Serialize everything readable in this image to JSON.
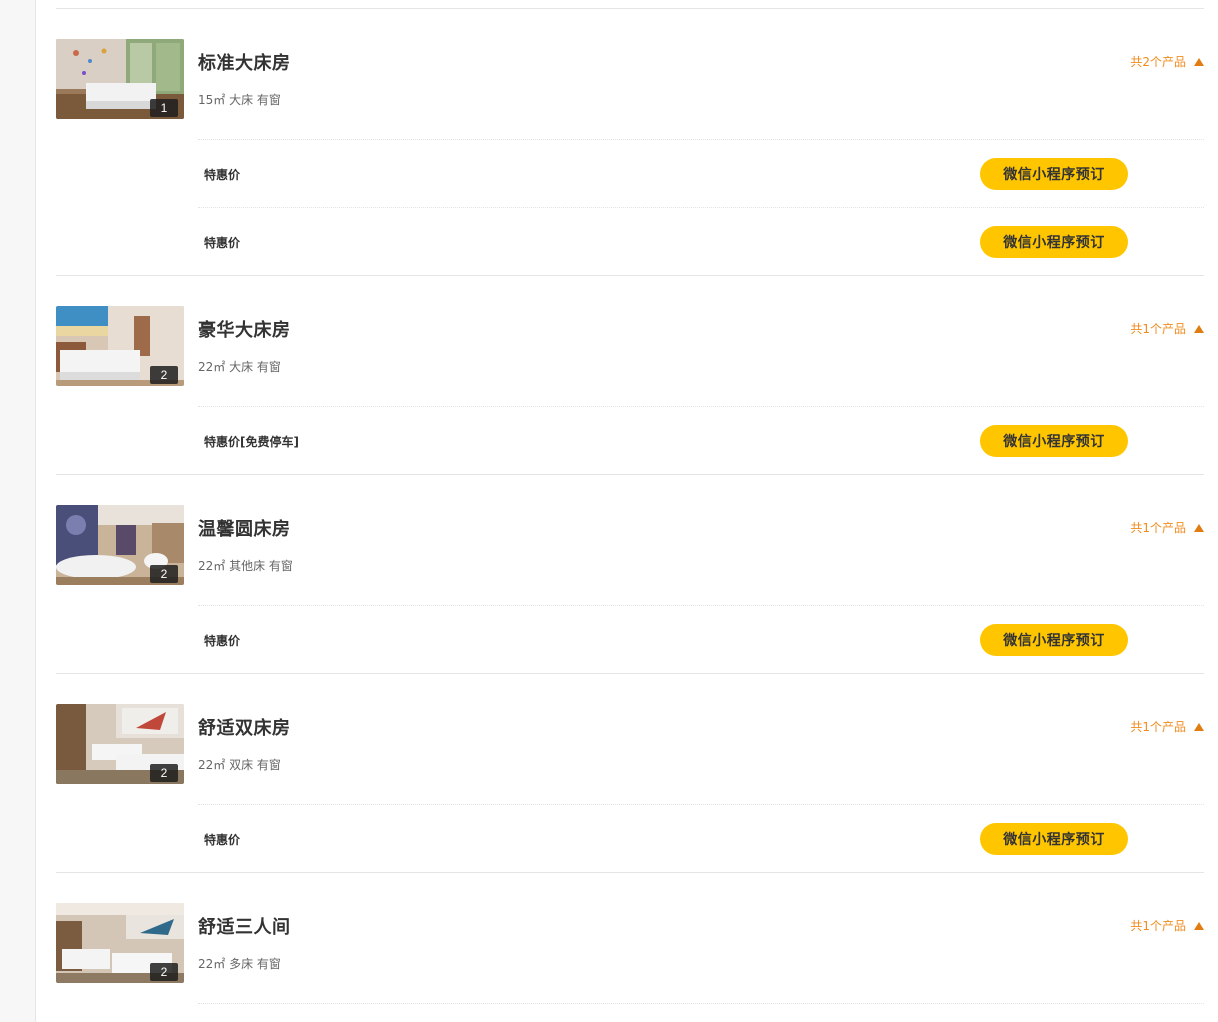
{
  "rooms": [
    {
      "name": "标准大床房",
      "meta": "15㎡ 大床 有窗",
      "photo_count": "1",
      "product_count": "共2个产品",
      "products": [
        {
          "name": "特惠价",
          "button": "微信小程序预订"
        },
        {
          "name": "特惠价",
          "button": "微信小程序预订"
        }
      ]
    },
    {
      "name": "豪华大床房",
      "meta": "22㎡ 大床 有窗",
      "photo_count": "2",
      "product_count": "共1个产品",
      "products": [
        {
          "name": "特惠价[免费停车]",
          "button": "微信小程序预订"
        }
      ]
    },
    {
      "name": "温馨圆床房",
      "meta": "22㎡ 其他床 有窗",
      "photo_count": "2",
      "product_count": "共1个产品",
      "products": [
        {
          "name": "特惠价",
          "button": "微信小程序预订"
        }
      ]
    },
    {
      "name": "舒适双床房",
      "meta": "22㎡ 双床 有窗",
      "photo_count": "2",
      "product_count": "共1个产品",
      "products": [
        {
          "name": "特惠价",
          "button": "微信小程序预订"
        }
      ]
    },
    {
      "name": "舒适三人间",
      "meta": "22㎡ 多床 有窗",
      "photo_count": "2",
      "product_count": "共1个产品",
      "products": []
    }
  ],
  "colors": {
    "accent": "#f08c1e",
    "button": "#ffc600",
    "divider": "#e5e5e5"
  },
  "icons": {
    "collapse": "triangle-up-icon"
  }
}
